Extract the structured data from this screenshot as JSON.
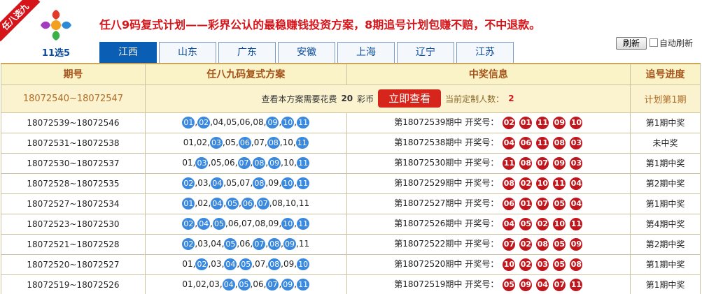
{
  "header": {
    "ribbon": "任八选九",
    "logo_text": "11选5",
    "headline": "任八9码复式计划——彩界公认的最稳赚钱投资方案，8期追号计划包赚不赔，不中退款。",
    "tabs": [
      "江西",
      "山东",
      "广东",
      "安徽",
      "上海",
      "辽宁",
      "江苏"
    ],
    "active_tab": 0,
    "refresh_label": "刷新",
    "auto_refresh_label": "自动刷新"
  },
  "table": {
    "columns": [
      "期号",
      "任八九码复式方案",
      "中奖信息",
      "追号进度"
    ],
    "promo": {
      "period": "18072540~18072547",
      "text": "查看本方案需要花费",
      "cost": "20",
      "unit": "彩币",
      "button": "立即查看",
      "count_label": "当前定制人数：",
      "count": "2",
      "progress": "计划第1期"
    },
    "rows": [
      {
        "period": "18072539~18072546",
        "nums": [
          {
            "n": "01",
            "h": true
          },
          {
            "n": "02",
            "h": true
          },
          {
            "n": "04",
            "h": false
          },
          {
            "n": "05",
            "h": false
          },
          {
            "n": "06",
            "h": false
          },
          {
            "n": "08",
            "h": false
          },
          {
            "n": "09",
            "h": true
          },
          {
            "n": "10",
            "h": true
          },
          {
            "n": "11",
            "h": true
          }
        ],
        "draw": "第18072539期中",
        "draw_label": "开奖号：",
        "balls": [
          "02",
          "01",
          "11",
          "09",
          "10"
        ],
        "progress": "第1期中奖"
      },
      {
        "period": "18072531~18072538",
        "nums": [
          {
            "n": "01",
            "h": false
          },
          {
            "n": "02",
            "h": false
          },
          {
            "n": "03",
            "h": true
          },
          {
            "n": "05",
            "h": false
          },
          {
            "n": "06",
            "h": true
          },
          {
            "n": "07",
            "h": false
          },
          {
            "n": "08",
            "h": true
          },
          {
            "n": "10",
            "h": false
          },
          {
            "n": "11",
            "h": true
          }
        ],
        "draw": "第18072538期中",
        "draw_label": "开奖号：",
        "balls": [
          "04",
          "06",
          "11",
          "08",
          "03"
        ],
        "progress": "未中奖"
      },
      {
        "period": "18072530~18072537",
        "nums": [
          {
            "n": "01",
            "h": false
          },
          {
            "n": "03",
            "h": true
          },
          {
            "n": "05",
            "h": false
          },
          {
            "n": "06",
            "h": false
          },
          {
            "n": "07",
            "h": true
          },
          {
            "n": "08",
            "h": true
          },
          {
            "n": "09",
            "h": true
          },
          {
            "n": "10",
            "h": false
          },
          {
            "n": "11",
            "h": true
          }
        ],
        "draw": "第18072530期中",
        "draw_label": "开奖号：",
        "balls": [
          "11",
          "08",
          "07",
          "09",
          "03"
        ],
        "progress": "第1期中奖"
      },
      {
        "period": "18072528~18072535",
        "nums": [
          {
            "n": "02",
            "h": true
          },
          {
            "n": "03",
            "h": false
          },
          {
            "n": "04",
            "h": true
          },
          {
            "n": "05",
            "h": false
          },
          {
            "n": "07",
            "h": false
          },
          {
            "n": "08",
            "h": true
          },
          {
            "n": "09",
            "h": false
          },
          {
            "n": "10",
            "h": true
          },
          {
            "n": "11",
            "h": true
          }
        ],
        "draw": "第18072529期中",
        "draw_label": "开奖号：",
        "balls": [
          "08",
          "02",
          "10",
          "11",
          "04"
        ],
        "progress": "第2期中奖"
      },
      {
        "period": "18072527~18072534",
        "nums": [
          {
            "n": "01",
            "h": true
          },
          {
            "n": "02",
            "h": false
          },
          {
            "n": "04",
            "h": true
          },
          {
            "n": "05",
            "h": true
          },
          {
            "n": "06",
            "h": true
          },
          {
            "n": "07",
            "h": true
          },
          {
            "n": "08",
            "h": false
          },
          {
            "n": "10",
            "h": false
          },
          {
            "n": "11",
            "h": false
          }
        ],
        "draw": "第18072527期中",
        "draw_label": "开奖号：",
        "balls": [
          "06",
          "01",
          "07",
          "05",
          "04"
        ],
        "progress": "第1期中奖"
      },
      {
        "period": "18072523~18072530",
        "nums": [
          {
            "n": "02",
            "h": true
          },
          {
            "n": "04",
            "h": true
          },
          {
            "n": "05",
            "h": true
          },
          {
            "n": "06",
            "h": false
          },
          {
            "n": "07",
            "h": false
          },
          {
            "n": "08",
            "h": false
          },
          {
            "n": "09",
            "h": false
          },
          {
            "n": "10",
            "h": true
          },
          {
            "n": "11",
            "h": true
          }
        ],
        "draw": "第18072526期中",
        "draw_label": "开奖号：",
        "balls": [
          "04",
          "05",
          "02",
          "10",
          "11"
        ],
        "progress": "第4期中奖"
      },
      {
        "period": "18072521~18072528",
        "nums": [
          {
            "n": "02",
            "h": true
          },
          {
            "n": "03",
            "h": false
          },
          {
            "n": "04",
            "h": false
          },
          {
            "n": "05",
            "h": true
          },
          {
            "n": "06",
            "h": false
          },
          {
            "n": "07",
            "h": true
          },
          {
            "n": "08",
            "h": true
          },
          {
            "n": "09",
            "h": true
          },
          {
            "n": "11",
            "h": false
          }
        ],
        "draw": "第18072522期中",
        "draw_label": "开奖号：",
        "balls": [
          "07",
          "02",
          "08",
          "05",
          "09"
        ],
        "progress": "第2期中奖"
      },
      {
        "period": "18072520~18072527",
        "nums": [
          {
            "n": "01",
            "h": false
          },
          {
            "n": "02",
            "h": true
          },
          {
            "n": "03",
            "h": false
          },
          {
            "n": "04",
            "h": true
          },
          {
            "n": "05",
            "h": true
          },
          {
            "n": "07",
            "h": false
          },
          {
            "n": "08",
            "h": true
          },
          {
            "n": "09",
            "h": false
          },
          {
            "n": "10",
            "h": true
          }
        ],
        "draw": "第18072520期中",
        "draw_label": "开奖号：",
        "balls": [
          "10",
          "02",
          "03",
          "05",
          "08"
        ],
        "progress": "第1期中奖"
      },
      {
        "period": "18072519~18072526",
        "nums": [
          {
            "n": "01",
            "h": false
          },
          {
            "n": "02",
            "h": false
          },
          {
            "n": "03",
            "h": false
          },
          {
            "n": "04",
            "h": true
          },
          {
            "n": "05",
            "h": true
          },
          {
            "n": "06",
            "h": false
          },
          {
            "n": "07",
            "h": true
          },
          {
            "n": "09",
            "h": true
          },
          {
            "n": "11",
            "h": true
          }
        ],
        "draw": "第18072519期中",
        "draw_label": "开奖号：",
        "balls": [
          "05",
          "09",
          "04",
          "07",
          "11"
        ],
        "progress": "第1期中奖"
      }
    ]
  },
  "colors": {
    "brand_red": "#d6151b",
    "tab_blue": "#0a5fb5",
    "highlight_ball": "#3b89df",
    "win_ball": "#c0161c",
    "header_bg": "#fbf3c8"
  }
}
